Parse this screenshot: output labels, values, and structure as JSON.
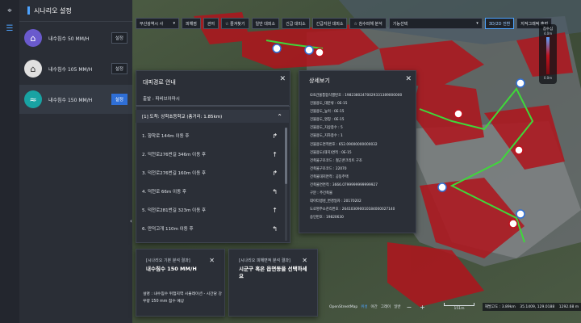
{
  "sidebar_icons": [
    "map-pin-icon",
    "list-icon"
  ],
  "scenario_panel": {
    "title": "시나리오 설정",
    "items": [
      {
        "label": "내수침수 50 MM/H",
        "button": "설정",
        "color": "#6a5acd",
        "icon": "house-flood-icon"
      },
      {
        "label": "내수침수 105 MM/H",
        "button": "설정",
        "color": "#e0e0e0",
        "icon": "house-rain-icon"
      },
      {
        "label": "내수침수 150 MM/H",
        "button": "설정",
        "color": "#18a3a3",
        "icon": "water-wave-icon"
      }
    ]
  },
  "toolbar": {
    "district": "부산광역시 사",
    "b1": "피해점",
    "b2": "관저",
    "b3": "☆ 즐겨찾기",
    "b4": "일반 대피소",
    "b5": "긴급 대피소",
    "b6": "긴급지원 대피소",
    "b7": "☆ 침수피해 분석",
    "select_label": "기능선택",
    "b8": "3D/2D 전환",
    "b9": "지적그래픽 출력"
  },
  "legend": {
    "title": "침수심",
    "max": "4.0m",
    "min": "0.0m"
  },
  "route_panel": {
    "title": "대피경로 안내",
    "origin": "출발 : 파비브아마시",
    "destination": "[1] 도착: 상학초등학교 (총거리: 1.85km)",
    "steps": [
      {
        "text": "1. 향학로 144m 이동 후",
        "turn": "↱"
      },
      {
        "text": "2. 덕천로276번길 346m 이동 후",
        "turn": "↑"
      },
      {
        "text": "3. 덕천로276번길 160m 이동 후",
        "turn": "↱"
      },
      {
        "text": "4. 덕천로 66m 이동 후",
        "turn": "↰"
      },
      {
        "text": "5. 덕천로281번길 323m 이동 후",
        "turn": "↑"
      },
      {
        "text": "6. 만덕고개 110m 이동 후",
        "turn": "↰"
      }
    ]
  },
  "detail_panel": {
    "title": "상세보기",
    "rows": [
      "GIS건물통합식별번호 : 19823802470029331389000000",
      "건물용도_대분류 : 0E-15",
      "건물용도_높이 : 0E-15",
      "건물용도_명칭 : 0E-15",
      "건물용도_지상층수 : 5",
      "건물용도_지하층수 : 1",
      "건물용도면적번호 : 652.09000000000032",
      "건물용도(대지)면적 : 0E-15",
      "건축물구조코드 : 철근콘크리트 구조",
      "건축물구조코드 : 22070",
      "건축물대지면적 : 공동주택",
      "건축물연면적 : 3666.0799999999999927",
      "구분 : 주건축물",
      "데이터생성_변경일자 : 20170202",
      "도로명주소관리번호 : 264103090010184000027140",
      "승인번호 : 19820630"
    ]
  },
  "result1": {
    "heading": "[시나리오 기본 분석 결과]",
    "value": "내수침수 150 MM/H",
    "description": "설명 : 내수침수 위험지역 시뮬레이션 - 시간당 강우량 150 mm 침수 예상"
  },
  "result2": {
    "heading": "[시나리오 피해면적 분석 결과]",
    "value": "시군구 혹은 읍면동을 선택하세요"
  },
  "bottom_bar": {
    "map_name": "OpenStreetMap",
    "t1": "위성",
    "t2": "야간",
    "t3": "그레이",
    "t4": "일반",
    "scale_label": "151m",
    "elevation": "해발고도 : 3.89km",
    "coords": "35.1409, 129.0188",
    "altitude": "1292.68 m"
  },
  "map_colors": {
    "flood": "#b0141c",
    "route": "#3fd83a",
    "base": "#4a5a45"
  }
}
